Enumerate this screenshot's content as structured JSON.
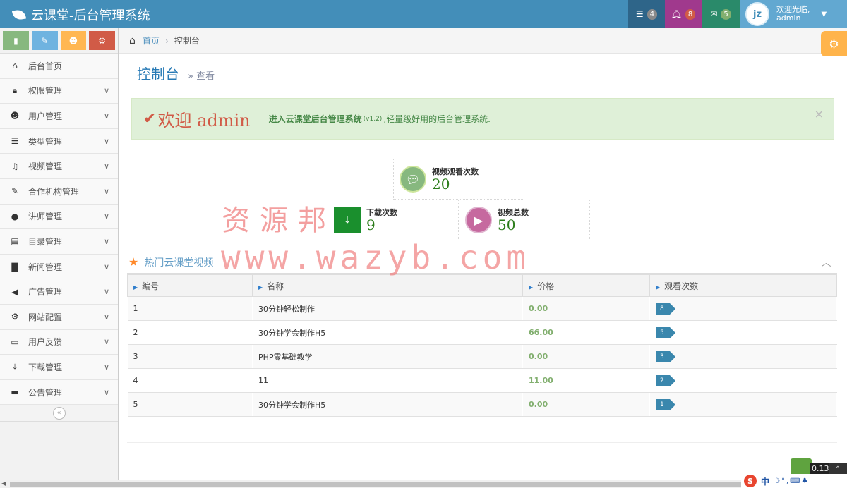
{
  "app": {
    "title": "云课堂-后台管理系统"
  },
  "top_bar": {
    "tasks_count": "4",
    "notifications_count": "8",
    "messages_count": "5",
    "user": {
      "avatar_text": "jz",
      "greeting": "欢迎光临,",
      "name": "admin"
    }
  },
  "sidebar": {
    "items": [
      {
        "label": "后台首页",
        "icon": "home-icon"
      },
      {
        "label": "权限管理",
        "icon": "lock-icon"
      },
      {
        "label": "用户管理",
        "icon": "users-icon"
      },
      {
        "label": "类型管理",
        "icon": "list-icon"
      },
      {
        "label": "视频管理",
        "icon": "music-icon"
      },
      {
        "label": "合作机构管理",
        "icon": "edit-icon"
      },
      {
        "label": "讲师管理",
        "icon": "user-icon"
      },
      {
        "label": "目录管理",
        "icon": "list-alt-icon"
      },
      {
        "label": "新闻管理",
        "icon": "file-icon"
      },
      {
        "label": "广告管理",
        "icon": "bullhorn-icon"
      },
      {
        "label": "网站配置",
        "icon": "cogs-icon"
      },
      {
        "label": "用户反馈",
        "icon": "folder-open-icon"
      },
      {
        "label": "下载管理",
        "icon": "download-icon"
      },
      {
        "label": "公告管理",
        "icon": "credit-card-icon"
      }
    ]
  },
  "breadcrumb": {
    "home": "首页",
    "current": "控制台"
  },
  "page_header": {
    "title": "控制台",
    "subtitle": "» 查看"
  },
  "alert": {
    "title": "欢迎 admin",
    "message": "进入云课堂后台管理系统",
    "version": "(v1.2)",
    "message2": ",轻量级好用的后台管理系统."
  },
  "stats": [
    {
      "label": "视频观看次数",
      "value": "20"
    },
    {
      "label": "下载次数",
      "value": "9"
    },
    {
      "label": "视频总数",
      "value": "50"
    }
  ],
  "watermark": {
    "line1": "资源邦",
    "line2": "www.wazyb.com"
  },
  "hot_videos": {
    "title": "热门云课堂视频",
    "columns": [
      "编号",
      "名称",
      "价格",
      "观看次数"
    ],
    "rows": [
      {
        "id": "1",
        "name": "30分钟轻松制作",
        "price": "0.00",
        "views": "8"
      },
      {
        "id": "2",
        "name": "30分钟学会制作H5",
        "price": "66.00",
        "views": "5"
      },
      {
        "id": "3",
        "name": "PHP零基础教学",
        "price": "0.00",
        "views": "3"
      },
      {
        "id": "4",
        "name": "11",
        "price": "11.00",
        "views": "2"
      },
      {
        "id": "5",
        "name": "30分钟学会制作H5",
        "price": "0.00",
        "views": "1"
      }
    ]
  },
  "overlay": {
    "speed": "0.13",
    "ime_zh": "中"
  }
}
